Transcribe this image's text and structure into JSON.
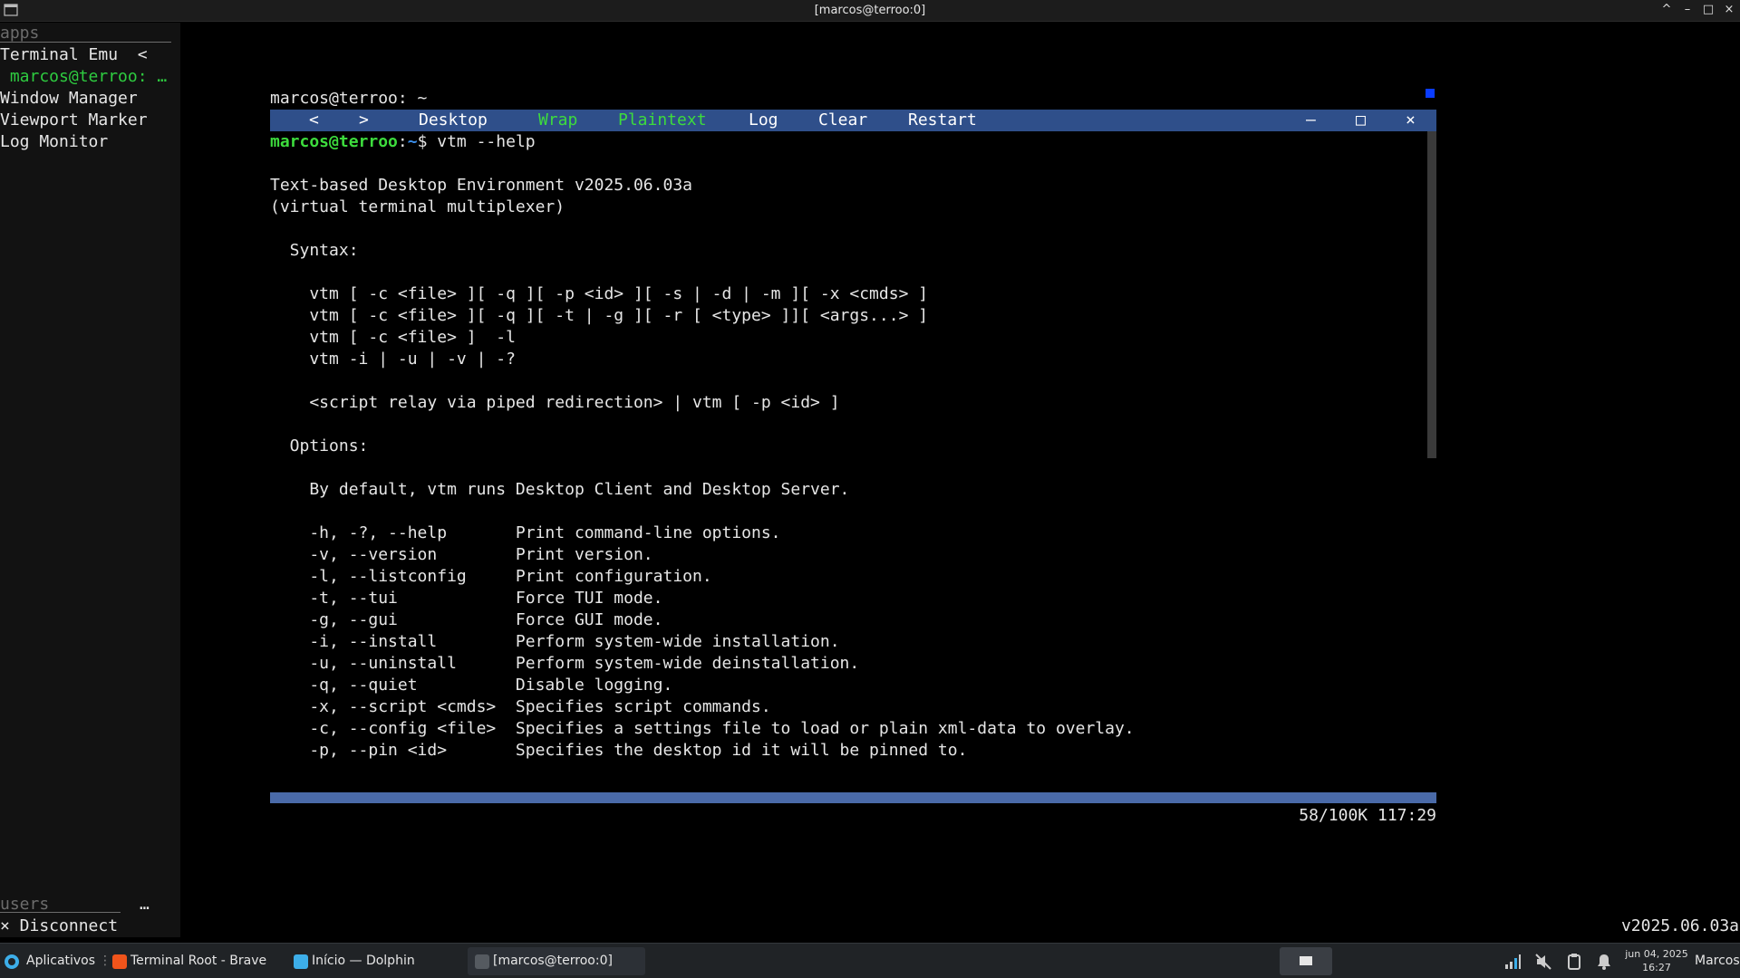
{
  "window": {
    "title": "[marcos@terroo:0]",
    "controls": [
      "^",
      "–",
      "□",
      "×"
    ]
  },
  "sidebar": {
    "apps_header": "apps",
    "items": [
      {
        "label": "Terminal Emu  <"
      },
      {
        "label": " marcos@terroo: …"
      },
      {
        "label": "Window Manager"
      },
      {
        "label": "Viewport Marker"
      },
      {
        "label": "Log Monitor"
      }
    ],
    "users_header": "users",
    "users_more": "…",
    "disconnect": "× Disconnect"
  },
  "desktop": {
    "outer_prompt": "marcos@terroo: ~",
    "version": "v2025.06.03a"
  },
  "terminal_window": {
    "menu": {
      "back": "<",
      "forward": ">",
      "desktop": "Desktop",
      "wrap": "Wrap",
      "plaintext": "Plaintext",
      "log": "Log",
      "clear": "Clear",
      "restart": "Restart",
      "minimize": "–",
      "maximize": "□",
      "close": "×"
    },
    "prompt_user": "marcos@terroo",
    "prompt_sep": ":",
    "prompt_path": "~",
    "prompt_cmd": "$ vtm --help",
    "lines": [
      "",
      "Text-based Desktop Environment v2025.06.03a",
      "(virtual terminal multiplexer)",
      "",
      "  Syntax:",
      "",
      "    vtm [ -c <file> ][ -q ][ -p <id> ][ -s | -d | -m ][ -x <cmds> ]",
      "    vtm [ -c <file> ][ -q ][ -t | -g ][ -r [ <type> ]][ <args...> ]",
      "    vtm [ -c <file> ]  -l",
      "    vtm -i | -u | -v | -?",
      "",
      "    <script relay via piped redirection> | vtm [ -p <id> ]",
      "",
      "  Options:",
      "",
      "    By default, vtm runs Desktop Client and Desktop Server.",
      "",
      "    -h, -?, --help       Print command-line options.",
      "    -v, --version        Print version.",
      "    -l, --listconfig     Print configuration.",
      "    -t, --tui            Force TUI mode.",
      "    -g, --gui            Force GUI mode.",
      "    -i, --install        Perform system-wide installation.",
      "    -u, --uninstall      Perform system-wide deinstallation.",
      "    -q, --quiet          Disable logging.",
      "    -x, --script <cmds>  Specifies script commands.",
      "    -c, --config <file>  Specifies a settings file to load or plain xml-data to overlay.",
      "    -p, --pin <id>       Specifies the desktop id it will be pinned to."
    ],
    "status": "58/100K 117:29"
  },
  "taskbar": {
    "launcher": "Aplicativos",
    "tasks": [
      {
        "label": "Terminal Root - Brave",
        "color": "#f0541b"
      },
      {
        "label": "Início — Dolphin",
        "color": "#3daee9"
      },
      {
        "label": "[marcos@terroo:0]",
        "color": "#555a60"
      }
    ],
    "clock_date": "jun 04, 2025",
    "clock_time": "16:27",
    "user": "Marcos"
  },
  "colors": {
    "menu_bar": "#2f4f8a",
    "accent_green": "#3ddc3d",
    "path_blue": "#3b8eea"
  }
}
